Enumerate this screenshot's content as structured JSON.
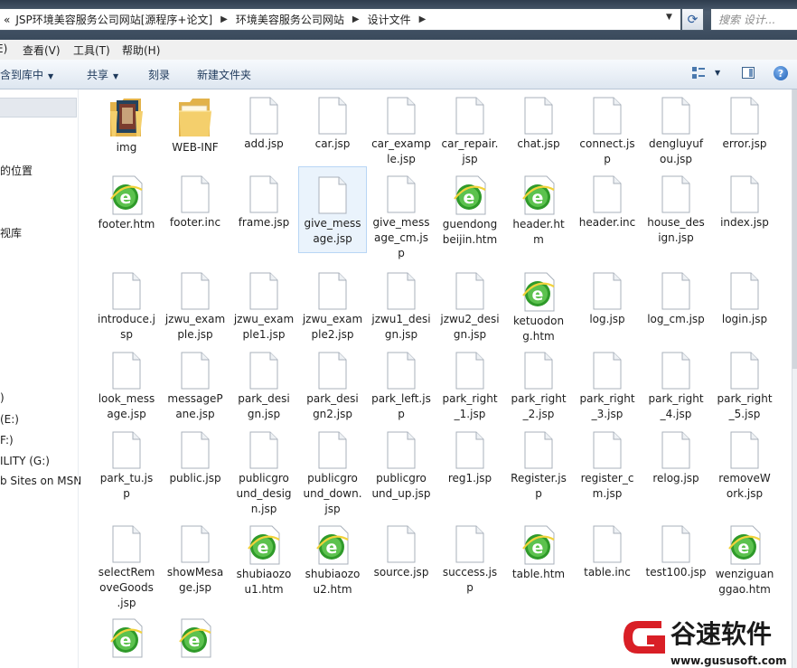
{
  "address_bar": {
    "crumbs": [
      "JSP环境美容服务公司网站[源程序+论文]",
      "环境美容服务公司网站",
      "设计文件"
    ],
    "prefix": "«",
    "search_placeholder": "搜索 设计..."
  },
  "menu": [
    {
      "label": "编辑(E)",
      "visible": "E)"
    },
    {
      "label": "查看(V)"
    },
    {
      "label": "工具(T)"
    },
    {
      "label": "帮助(H)"
    }
  ],
  "commands": {
    "include_library": "包含到库中",
    "share": "共享",
    "burn": "刻录",
    "new_folder": "新建文件夹"
  },
  "nav": [
    "的位置",
    "视库",
    ")",
    "(E:)",
    "F:)",
    "ILITY (G:)",
    "b Sites on MSN"
  ],
  "files": [
    {
      "name": "img",
      "lines": [
        "img"
      ],
      "kind": "folder-img"
    },
    {
      "name": "WEB-INF",
      "lines": [
        "WEB-INF"
      ],
      "kind": "folder"
    },
    {
      "name": "add.jsp",
      "lines": [
        "add.jsp"
      ],
      "kind": "doc"
    },
    {
      "name": "car.jsp",
      "lines": [
        "car.jsp"
      ],
      "kind": "doc"
    },
    {
      "name": "car_example.jsp",
      "lines": [
        "car_examp",
        "le.jsp"
      ],
      "kind": "doc"
    },
    {
      "name": "car_repair.jsp",
      "lines": [
        "car_repair.",
        "jsp"
      ],
      "kind": "doc"
    },
    {
      "name": "chat.jsp",
      "lines": [
        "chat.jsp"
      ],
      "kind": "doc"
    },
    {
      "name": "connect.jsp",
      "lines": [
        "connect.js",
        "p"
      ],
      "kind": "doc"
    },
    {
      "name": "dengluyufou.jsp",
      "lines": [
        "dengluyuf",
        "ou.jsp"
      ],
      "kind": "doc"
    },
    {
      "name": "error.jsp",
      "lines": [
        "error.jsp"
      ],
      "kind": "doc"
    },
    {
      "name": "footer.htm",
      "lines": [
        "footer.htm"
      ],
      "kind": "ie"
    },
    {
      "name": "footer.inc",
      "lines": [
        "footer.inc"
      ],
      "kind": "doc"
    },
    {
      "name": "frame.jsp",
      "lines": [
        "frame.jsp"
      ],
      "kind": "doc"
    },
    {
      "name": "give_message.jsp",
      "lines": [
        "give_mess",
        "age.jsp"
      ],
      "kind": "doc",
      "selected": true
    },
    {
      "name": "give_message_cm.jsp",
      "lines": [
        "give_mess",
        "age_cm.js",
        "p"
      ],
      "kind": "doc"
    },
    {
      "name": "guendongbeijin.htm",
      "lines": [
        "guendong",
        "beijin.htm"
      ],
      "kind": "ie"
    },
    {
      "name": "header.htm",
      "lines": [
        "header.ht",
        "m"
      ],
      "kind": "ie"
    },
    {
      "name": "header.inc",
      "lines": [
        "header.inc"
      ],
      "kind": "doc"
    },
    {
      "name": "house_design.jsp",
      "lines": [
        "house_des",
        "ign.jsp"
      ],
      "kind": "doc"
    },
    {
      "name": "index.jsp",
      "lines": [
        "index.jsp"
      ],
      "kind": "doc"
    },
    {
      "name": "introduce.jsp",
      "lines": [
        "introduce.j",
        "sp"
      ],
      "kind": "doc"
    },
    {
      "name": "jzwu_example.jsp",
      "lines": [
        "jzwu_exam",
        "ple.jsp"
      ],
      "kind": "doc"
    },
    {
      "name": "jzwu_example1.jsp",
      "lines": [
        "jzwu_exam",
        "ple1.jsp"
      ],
      "kind": "doc"
    },
    {
      "name": "jzwu_example2.jsp",
      "lines": [
        "jzwu_exam",
        "ple2.jsp"
      ],
      "kind": "doc"
    },
    {
      "name": "jzwu1_design.jsp",
      "lines": [
        "jzwu1_desi",
        "gn.jsp"
      ],
      "kind": "doc"
    },
    {
      "name": "jzwu2_design.jsp",
      "lines": [
        "jzwu2_desi",
        "gn.jsp"
      ],
      "kind": "doc"
    },
    {
      "name": "ketuodong.htm",
      "lines": [
        "ketuodon",
        "g.htm"
      ],
      "kind": "ie"
    },
    {
      "name": "log.jsp",
      "lines": [
        "log.jsp"
      ],
      "kind": "doc"
    },
    {
      "name": "log_cm.jsp",
      "lines": [
        "log_cm.jsp"
      ],
      "kind": "doc"
    },
    {
      "name": "login.jsp",
      "lines": [
        "login.jsp"
      ],
      "kind": "doc"
    },
    {
      "name": "look_message.jsp",
      "lines": [
        "look_mess",
        "age.jsp"
      ],
      "kind": "doc"
    },
    {
      "name": "messagePane.jsp",
      "lines": [
        "messageP",
        "ane.jsp"
      ],
      "kind": "doc"
    },
    {
      "name": "park_design.jsp",
      "lines": [
        "park_desi",
        "gn.jsp"
      ],
      "kind": "doc"
    },
    {
      "name": "park_design2.jsp",
      "lines": [
        "park_desi",
        "gn2.jsp"
      ],
      "kind": "doc"
    },
    {
      "name": "park_left.jsp",
      "lines": [
        "park_left.js",
        "p"
      ],
      "kind": "doc"
    },
    {
      "name": "park_right_1.jsp",
      "lines": [
        "park_right",
        "_1.jsp"
      ],
      "kind": "doc"
    },
    {
      "name": "park_right_2.jsp",
      "lines": [
        "park_right",
        "_2.jsp"
      ],
      "kind": "doc"
    },
    {
      "name": "park_right_3.jsp",
      "lines": [
        "park_right",
        "_3.jsp"
      ],
      "kind": "doc"
    },
    {
      "name": "park_right_4.jsp",
      "lines": [
        "park_right",
        "_4.jsp"
      ],
      "kind": "doc"
    },
    {
      "name": "park_right_5.jsp",
      "lines": [
        "park_right",
        "_5.jsp"
      ],
      "kind": "doc"
    },
    {
      "name": "park_tu.jsp",
      "lines": [
        "park_tu.js",
        "p"
      ],
      "kind": "doc"
    },
    {
      "name": "public.jsp",
      "lines": [
        "public.jsp"
      ],
      "kind": "doc"
    },
    {
      "name": "publicground_design.jsp",
      "lines": [
        "publicgro",
        "und_desig",
        "n.jsp"
      ],
      "kind": "doc"
    },
    {
      "name": "publicground_down.jsp",
      "lines": [
        "publicgro",
        "und_down.",
        "jsp"
      ],
      "kind": "doc"
    },
    {
      "name": "publicground_up.jsp",
      "lines": [
        "publicgro",
        "und_up.jsp"
      ],
      "kind": "doc"
    },
    {
      "name": "reg1.jsp",
      "lines": [
        "reg1.jsp"
      ],
      "kind": "doc"
    },
    {
      "name": "Register.jsp",
      "lines": [
        "Register.js",
        "p"
      ],
      "kind": "doc"
    },
    {
      "name": "register_cm.jsp",
      "lines": [
        "register_c",
        "m.jsp"
      ],
      "kind": "doc"
    },
    {
      "name": "relog.jsp",
      "lines": [
        "relog.jsp"
      ],
      "kind": "doc"
    },
    {
      "name": "removeWork.jsp",
      "lines": [
        "removeW",
        "ork.jsp"
      ],
      "kind": "doc"
    },
    {
      "name": "selectRemoveGoods.jsp",
      "lines": [
        "selectRem",
        "oveGoods",
        ".jsp"
      ],
      "kind": "doc"
    },
    {
      "name": "showMesage.jsp",
      "lines": [
        "showMesa",
        "ge.jsp"
      ],
      "kind": "doc"
    },
    {
      "name": "shubiaozou1.htm",
      "lines": [
        "shubiaozo",
        "u1.htm"
      ],
      "kind": "ie"
    },
    {
      "name": "shubiaozou2.htm",
      "lines": [
        "shubiaozo",
        "u2.htm"
      ],
      "kind": "ie"
    },
    {
      "name": "source.jsp",
      "lines": [
        "source.jsp"
      ],
      "kind": "doc"
    },
    {
      "name": "success.jsp",
      "lines": [
        "success.js",
        "p"
      ],
      "kind": "doc"
    },
    {
      "name": "table.htm",
      "lines": [
        "table.htm"
      ],
      "kind": "ie"
    },
    {
      "name": "table.inc",
      "lines": [
        "table.inc"
      ],
      "kind": "doc"
    },
    {
      "name": "test100.jsp",
      "lines": [
        "test100.jsp"
      ],
      "kind": "doc"
    },
    {
      "name": "wenziguanggao.htm",
      "lines": [
        "wenziguan",
        "ggao.htm"
      ],
      "kind": "ie"
    },
    {
      "name": "",
      "lines": [],
      "kind": "ie"
    },
    {
      "name": "",
      "lines": [],
      "kind": "ie"
    }
  ],
  "watermark": {
    "title": "谷速软件",
    "url": "www.gususoft.com",
    "colors": {
      "red": "#d91f26",
      "dark": "#1a1a1a"
    }
  }
}
